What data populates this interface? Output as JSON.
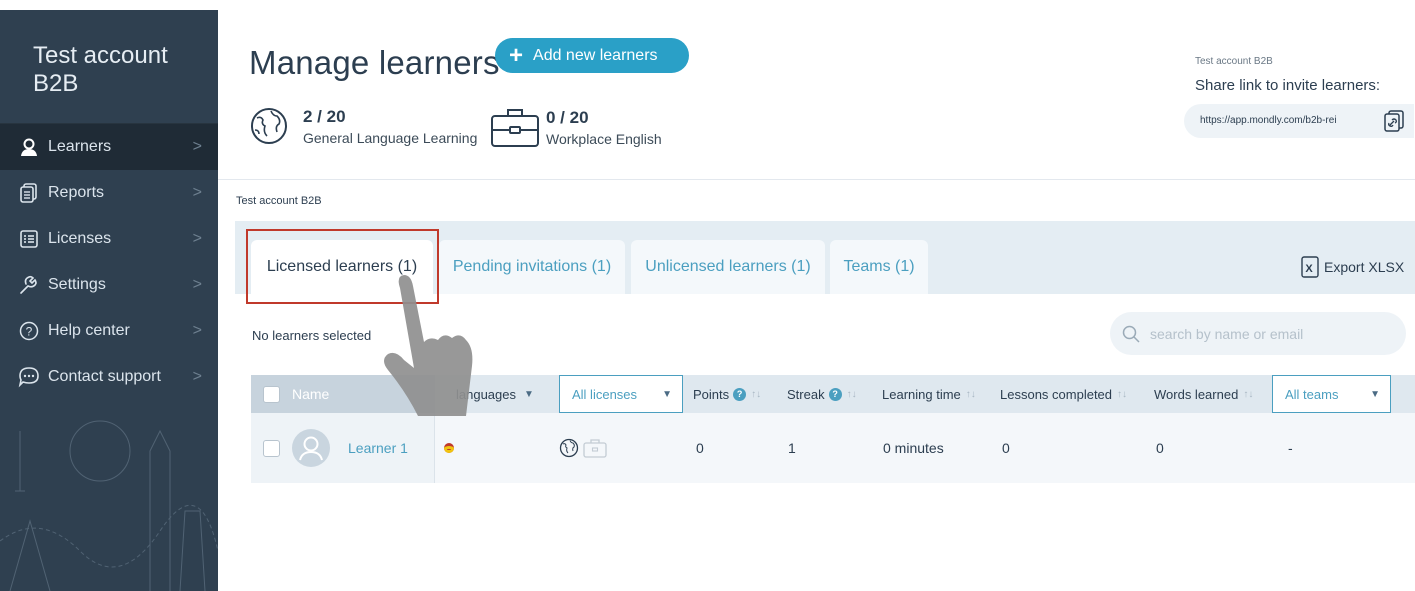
{
  "sidebar": {
    "account": "Test account B2B",
    "items": [
      {
        "label": "Learners",
        "icon": "user-icon",
        "active": true
      },
      {
        "label": "Reports",
        "icon": "reports-icon"
      },
      {
        "label": "Licenses",
        "icon": "licenses-icon"
      },
      {
        "label": "Settings",
        "icon": "settings-icon"
      },
      {
        "label": "Help center",
        "icon": "help-icon"
      },
      {
        "label": "Contact support",
        "icon": "chat-icon"
      }
    ]
  },
  "header": {
    "title": "Manage learners",
    "add_button": "Add new learners",
    "stats": [
      {
        "value": "2 / 20",
        "label": "General Language Learning",
        "icon": "globe-icon"
      },
      {
        "value": "0 / 20",
        "label": "Workplace English",
        "icon": "briefcase-icon"
      }
    ],
    "share": {
      "account": "Test account B2B",
      "title": "Share link to invite learners:",
      "url": "https://app.mondly.com/b2b-rei"
    }
  },
  "breadcrumb": "Test account B2B",
  "tabs": [
    {
      "label": "Licensed learners (1)",
      "active": true
    },
    {
      "label": "Pending invitations (1)"
    },
    {
      "label": "Unlicensed learners (1)"
    },
    {
      "label": "Teams (1)"
    }
  ],
  "export_label": "Export XLSX",
  "selection_status": "No learners selected",
  "search_placeholder": "search by name or email",
  "table": {
    "headers": {
      "name": "Name",
      "languages": "languages",
      "licenses": "All licenses",
      "points": "Points",
      "streak": "Streak",
      "learning_time": "Learning time",
      "lessons": "Lessons completed",
      "words": "Words learned",
      "teams": "All teams"
    },
    "rows": [
      {
        "name": "Learner 1",
        "language_flag": "spain-flag",
        "points": "0",
        "streak": "1",
        "learning_time": "0 minutes",
        "lessons": "0",
        "words": "0",
        "team": "-"
      }
    ]
  },
  "colors": {
    "sidebar_bg": "#2f4050",
    "accent": "#2aa0c7",
    "highlight_box": "#c0392b"
  }
}
